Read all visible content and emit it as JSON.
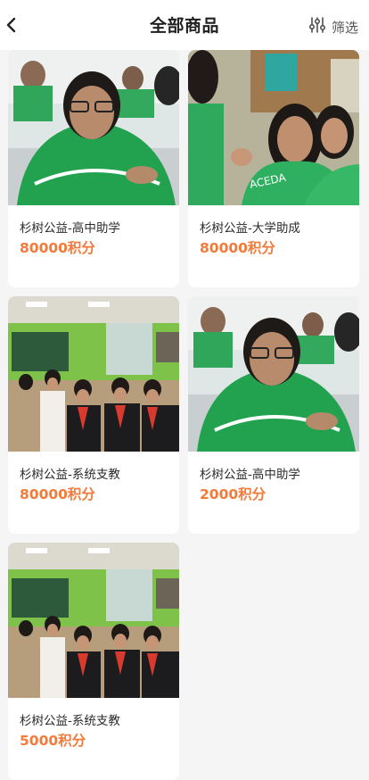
{
  "header": {
    "title": "全部商品",
    "filter_label": "筛选"
  },
  "products": [
    {
      "name": "杉树公益-高中助学",
      "price": "80000积分",
      "image": "students-green-uniform"
    },
    {
      "name": "杉树公益-大学助成",
      "price": "80000积分",
      "image": "college-volunteers"
    },
    {
      "name": "杉树公益-系统支教",
      "price": "80000积分",
      "image": "classroom-children"
    },
    {
      "name": "杉树公益-高中助学",
      "price": "2000积分",
      "image": "students-green-uniform"
    },
    {
      "name": "杉树公益-系统支教",
      "price": "5000积分",
      "image": "classroom-children"
    }
  ],
  "colors": {
    "price": "#f47a3a",
    "background": "#f5f5f6",
    "card": "#ffffff"
  }
}
